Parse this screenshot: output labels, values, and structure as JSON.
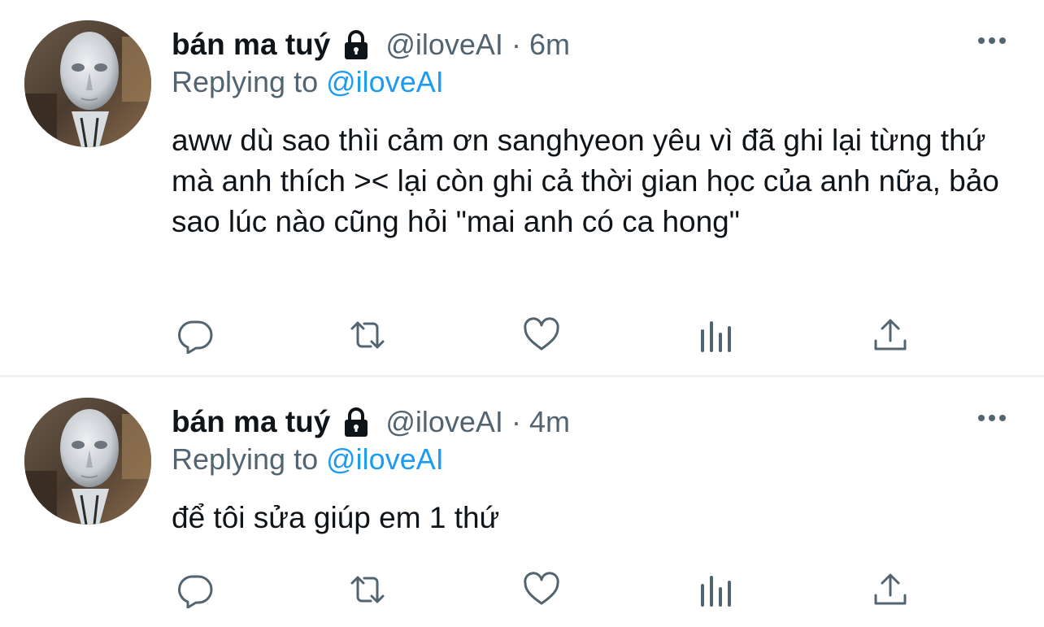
{
  "colors": {
    "text_primary": "#0f1419",
    "text_secondary": "#536471",
    "accent": "#1d9bf0",
    "divider": "#eff3f4"
  },
  "tweets": [
    {
      "display_name": "bán ma tuý",
      "protected_icon": "lock-icon",
      "handle": "@iloveAI",
      "separator": "·",
      "time": "6m",
      "replying_prefix": "Replying to",
      "replying_to": "@iloveAI",
      "text": "aww dù sao thìi cảm ơn sanghyeon yêu vì đã ghi lại từng thứ mà anh thích >< lại còn ghi cả thời gian học của anh nữa, bảo sao lúc nào cũng hỏi \"mai anh có ca hong\"",
      "actions": [
        "reply-icon",
        "retweet-icon",
        "like-icon",
        "analytics-icon",
        "share-icon"
      ]
    },
    {
      "display_name": "bán ma tuý",
      "protected_icon": "lock-icon",
      "handle": "@iloveAI",
      "separator": "·",
      "time": "4m",
      "replying_prefix": "Replying to",
      "replying_to": "@iloveAI",
      "text": "để tôi sửa giúp em 1 thứ",
      "actions": [
        "reply-icon",
        "retweet-icon",
        "like-icon",
        "analytics-icon",
        "share-icon"
      ]
    }
  ]
}
